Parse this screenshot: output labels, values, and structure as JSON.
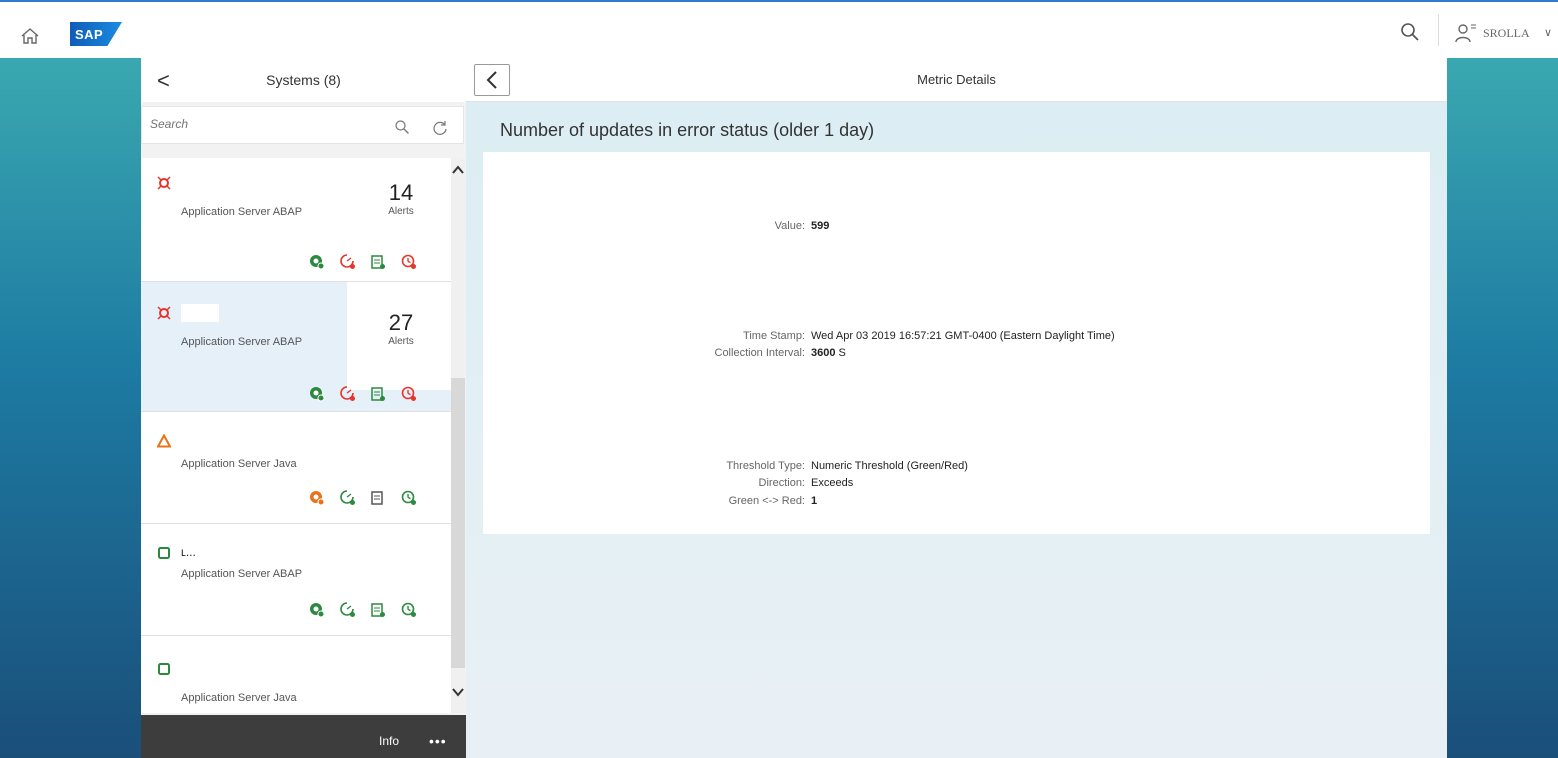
{
  "shell": {
    "logo_text": "SAP",
    "user_name": "SROLLA",
    "user_chevron": "∨"
  },
  "master": {
    "back_glyph": "<",
    "title": "Systems (8)",
    "search_placeholder": "Search",
    "items": [
      {
        "status": "critical-red",
        "name": "Application Server ABAP",
        "count": "14",
        "count_label": "Alerts",
        "selected": false
      },
      {
        "status": "critical-red",
        "name": "Application Server ABAP",
        "count": "27",
        "count_label": "Alerts",
        "selected": true
      },
      {
        "status": "warning-orange",
        "name": "Application Server Java",
        "selected": false
      },
      {
        "status": "ok-green",
        "title_fragment": "ʟ...",
        "name": "Application Server ABAP",
        "selected": false
      },
      {
        "status": "ok-green",
        "name": "Application Server Java",
        "selected": false
      }
    ],
    "footer": {
      "info_label": "Info",
      "more_label": "•••"
    }
  },
  "detail": {
    "header_title": "Metric Details",
    "metric_title": "Number of updates in error status (older 1 day)",
    "fields": {
      "value_label": "Value:",
      "value": "599",
      "timestamp_label": "Time Stamp:",
      "timestamp": "Wed Apr 03 2019 16:57:21 GMT-0400 (Eastern Daylight Time)",
      "interval_label": "Collection Interval:",
      "interval_value": "3600",
      "interval_unit": "S",
      "threshold_type_label": "Threshold Type:",
      "threshold_type": "Numeric Threshold (Green/Red)",
      "direction_label": "Direction:",
      "direction": "Exceeds",
      "green_red_label": "Green <-> Red:",
      "green_red": "1"
    }
  },
  "colors": {
    "critical": "#e5352c",
    "warning": "#e8731a",
    "ok": "#2b8a3e",
    "accent": "#2e7bcf"
  }
}
